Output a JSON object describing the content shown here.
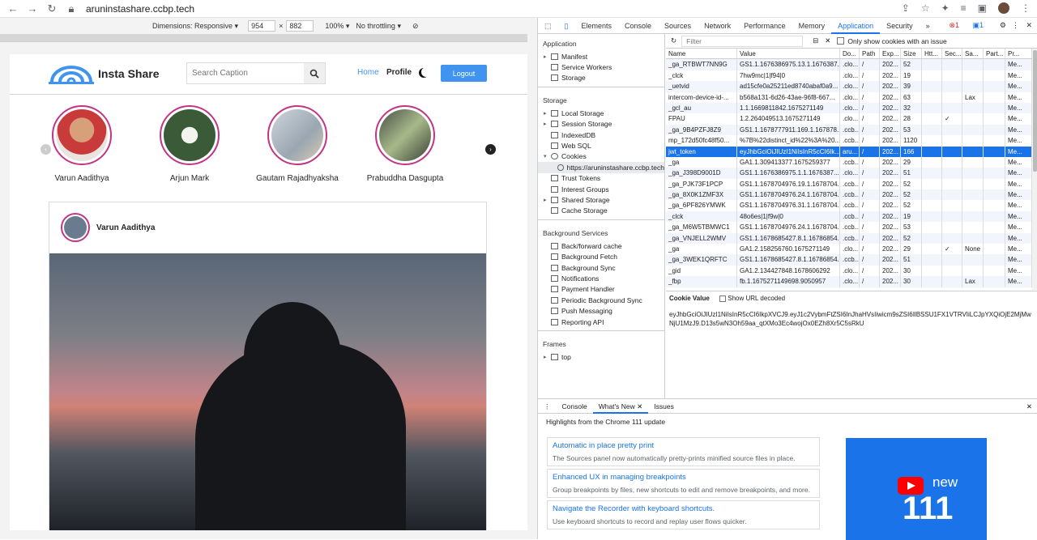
{
  "browser": {
    "url": "aruninstashare.ccbp.tech"
  },
  "device_toolbar": {
    "dimensions_label": "Dimensions: Responsive",
    "width": "954",
    "height": "882",
    "zoom": "100%",
    "throttle": "No throttling"
  },
  "app": {
    "brand": "Insta Share",
    "search_placeholder": "Search Caption",
    "nav_home": "Home",
    "nav_profile": "Profile",
    "logout": "Logout",
    "stories": [
      "Varun Aadithya",
      "Arjun Mark",
      "Gautam Rajadhyaksha",
      "Prabuddha Dasgupta"
    ],
    "post_user": "Varun Aadithya"
  },
  "devtools": {
    "tabs": [
      "Elements",
      "Console",
      "Sources",
      "Network",
      "Performance",
      "Memory",
      "Application",
      "Security"
    ],
    "badges": {
      "errors": "1",
      "messages": "1"
    },
    "sidebar": {
      "application_title": "Application",
      "application_items": [
        "Manifest",
        "Service Workers",
        "Storage"
      ],
      "storage_title": "Storage",
      "storage_items": [
        "Local Storage",
        "Session Storage",
        "IndexedDB",
        "Web SQL",
        "Cookies"
      ],
      "cookie_origin": "https://aruninstashare.ccbp.tech",
      "storage_items2": [
        "Trust Tokens",
        "Interest Groups",
        "Shared Storage",
        "Cache Storage"
      ],
      "bg_title": "Background Services",
      "bg_items": [
        "Back/forward cache",
        "Background Fetch",
        "Background Sync",
        "Notifications",
        "Payment Handler",
        "Periodic Background Sync",
        "Push Messaging",
        "Reporting API"
      ],
      "frames_title": "Frames",
      "frames_items": [
        "top"
      ]
    },
    "filter_placeholder": "Filter",
    "issue_checkbox": "Only show cookies with an issue",
    "columns": [
      "Name",
      "Value",
      "Do...",
      "Path",
      "Exp...",
      "Size",
      "Htt...",
      "Sec...",
      "Sa...",
      "Part...",
      "Pr..."
    ],
    "rows": [
      [
        "_ga_RTBWT7NN9G",
        "GS1.1.1676386975.13.1.1676387...",
        ".clo...",
        "/",
        "202...",
        "52",
        "",
        "",
        "",
        "",
        "Me..."
      ],
      [
        "_clck",
        "7hw9mc|1|f94|0",
        ".clo...",
        "/",
        "202...",
        "19",
        "",
        "",
        "",
        "",
        "Me..."
      ],
      [
        "_uetvid",
        "ad15cfe0a25211ed8740abaf0a9...",
        ".clo...",
        "/",
        "202...",
        "39",
        "",
        "",
        "",
        "",
        "Me..."
      ],
      [
        "intercom-device-id-...",
        "b568a131-6d26-43ae-96f8-667...",
        ".clo...",
        "/",
        "202...",
        "63",
        "",
        "",
        "Lax",
        "",
        "Me..."
      ],
      [
        "_gcl_au",
        "1.1.1669811842.1675271149",
        ".clo...",
        "/",
        "202...",
        "32",
        "",
        "",
        "",
        "",
        "Me..."
      ],
      [
        "FPAU",
        "1.2.264049513.1675271149",
        ".clo...",
        "/",
        "202...",
        "28",
        "",
        "✓",
        "",
        "",
        "Me..."
      ],
      [
        "_ga_9B4PZFJ8Z9",
        "GS1.1.1678777911.169.1.167878...",
        ".ccb...",
        "/",
        "202...",
        "53",
        "",
        "",
        "",
        "",
        "Me..."
      ],
      [
        "mp_172d50fc48f50...",
        "%7B%22distinct_id%22%3A%20...",
        ".ccb...",
        "/",
        "202...",
        "1120",
        "",
        "",
        "",
        "",
        "Me..."
      ],
      [
        "jwt_token",
        "eyJhbGciOiJIUzI1NiIsInR5cCI6Ik...",
        "aru...",
        "/",
        "202...",
        "166",
        "",
        "",
        "",
        "",
        "Me..."
      ],
      [
        "_ga",
        "GA1.1.309413377.1675259377",
        ".ccb...",
        "/",
        "202...",
        "29",
        "",
        "",
        "",
        "",
        "Me..."
      ],
      [
        "_ga_J398D9001D",
        "GS1.1.1676386975.1.1.1676387...",
        ".clo...",
        "/",
        "202...",
        "51",
        "",
        "",
        "",
        "",
        "Me..."
      ],
      [
        "_ga_PJK73F1PCP",
        "GS1.1.1678704976.19.1.1678704...",
        ".ccb...",
        "/",
        "202...",
        "52",
        "",
        "",
        "",
        "",
        "Me..."
      ],
      [
        "_ga_8X0K1ZMF3X",
        "GS1.1.1678704976.24.1.1678704...",
        ".ccb...",
        "/",
        "202...",
        "52",
        "",
        "",
        "",
        "",
        "Me..."
      ],
      [
        "_ga_6PF826YMWK",
        "GS1.1.1678704976.31.1.1678704...",
        ".ccb...",
        "/",
        "202...",
        "52",
        "",
        "",
        "",
        "",
        "Me..."
      ],
      [
        "_clck",
        "48o6es|1|f9w|0",
        ".ccb...",
        "/",
        "202...",
        "19",
        "",
        "",
        "",
        "",
        "Me..."
      ],
      [
        "_ga_M6W5TBMWC1",
        "GS1.1.1678704976.24.1.1678704...",
        ".ccb...",
        "/",
        "202...",
        "53",
        "",
        "",
        "",
        "",
        "Me..."
      ],
      [
        "_ga_VNJELL2WMV",
        "GS1.1.1678685427.8.1.16786854...",
        ".ccb...",
        "/",
        "202...",
        "52",
        "",
        "",
        "",
        "",
        "Me..."
      ],
      [
        "_ga",
        "GA1.2.158256760.1675271149",
        ".clo...",
        "/",
        "202...",
        "29",
        "",
        "✓",
        "None",
        "",
        "Me..."
      ],
      [
        "_ga_3WEK1QRFTC",
        "GS1.1.1678685427.8.1.16786854...",
        ".ccb...",
        "/",
        "202...",
        "51",
        "",
        "",
        "",
        "",
        "Me..."
      ],
      [
        "_gid",
        "GA1.2.134427848.1678606292",
        ".clo...",
        "/",
        "202...",
        "30",
        "",
        "",
        "",
        "",
        "Me..."
      ],
      [
        "_fbp",
        "fb.1.1675271149698.9050957",
        ".clo...",
        "/",
        "202...",
        "30",
        "",
        "",
        "Lax",
        "",
        "Me..."
      ]
    ],
    "cookie_value_title": "Cookie Value",
    "show_url_decoded": "Show URL decoded",
    "cookie_value": "eyJhbGciOiJIUzI1NiIsInR5cCI6IkpXVCJ9.eyJ1c2VybmFtZSI6InJhaHVsIiwicm9sZSI6IlBSSU1FX1VTRVIiLCJpYXQiOjE2MjMwNjU1MzJ9.D13s5wN3Oh59aa_qtXMo3Ec4wojOx0EZh8Xr5C5sRkU",
    "drawer_tabs": [
      "Console",
      "What's New",
      "Issues"
    ],
    "highlights": "Highlights from the Chrome 111 update",
    "cards": [
      {
        "title": "Automatic in place pretty print",
        "desc": "The Sources panel now automatically pretty-prints minified source files in place."
      },
      {
        "title": "Enhanced UX in managing breakpoints",
        "desc": "Group breakpoints by files, new shortcuts to edit and remove breakpoints, and more."
      },
      {
        "title": "Navigate the Recorder with keyboard shortcuts.",
        "desc": "Use keyboard shortcuts to record and replay user flows quicker."
      }
    ],
    "promo_new": "new",
    "promo_version": "111"
  }
}
